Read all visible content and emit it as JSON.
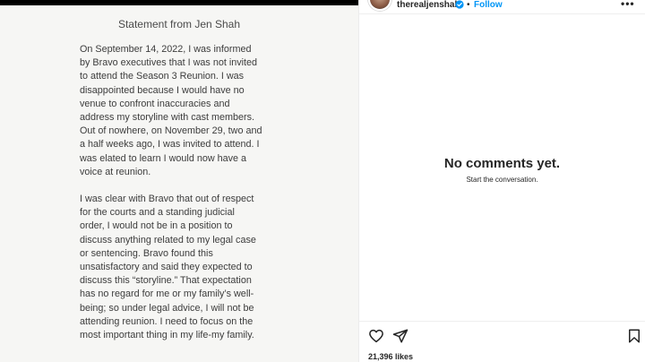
{
  "statement": {
    "title": "Statement from Jen Shah",
    "paragraphs": [
      "On September 14, 2022, I was informed\nby Bravo executives that I was not invited\nto attend the Season 3 Reunion. I was\ndisappointed because I would have no\nvenue to confront inaccuracies and\naddress my storyline with cast members.\nOut of nowhere, on November 29, two and\na half weeks ago, I was invited to attend. I\nwas elated to learn I would now have a\nvoice at reunion.",
      "I was clear with Bravo that out of respect\nfor the courts and a standing judicial\norder, I would not be in a position to\ndiscuss anything related to my legal case\nor sentencing. Bravo found this\nunsatisfactory and said they expected to\ndiscuss this “storyline.” That expectation\nhas no regard for me or my family’s well-\nbeing; so under legal advice, I will not be\nattending reunion. I need to focus on the\nmost important thing in my life-my family."
    ]
  },
  "header": {
    "username": "therealjenshah",
    "separator": "•",
    "follow_label": "Follow",
    "more_label": "•••"
  },
  "comments": {
    "empty_title": "No comments yet.",
    "empty_subtitle": "Start the conversation."
  },
  "actions": {
    "icons": [
      "heart-icon",
      "share-icon",
      "bookmark-icon"
    ]
  },
  "likes": {
    "text": "21,396 likes"
  },
  "colors": {
    "link_blue": "#0095f6",
    "verified_blue": "#0095f6",
    "text_dark": "#262626"
  }
}
